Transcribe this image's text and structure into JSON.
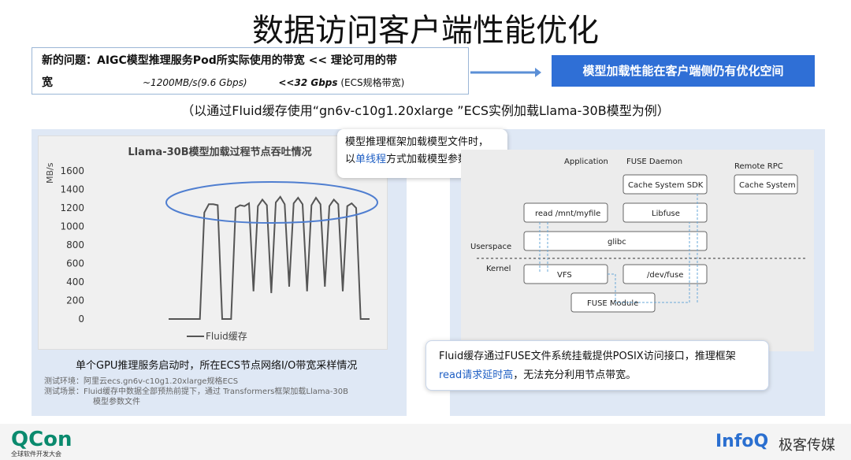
{
  "title": "数据访问客户端性能优化",
  "problem": {
    "line1": "新的问题：AIGC模型推理服务Pod所实际使用的带宽 << 理论可用的带",
    "line2": "宽",
    "actual": "~1200MB/s(9.6 Gbps)",
    "theory": "<<32 Gbps",
    "theory_note": "(ECS规格带宽)"
  },
  "conclusion": "模型加载性能在客户端侧仍有优化空间",
  "subtitle": "（以通过Fluid缓存使用“gn6v-c10g1.20xlarge ”ECS实例加载Llama-30B模型为例）",
  "callout1": {
    "line1": "模型推理框架加载模型文件时，",
    "pre": "以",
    "hl": "单线程",
    "post": "方式加载模型参数"
  },
  "caption1": "单个GPU推理服务启动时，所在ECS节点网络I/O带宽采样情况",
  "testenv": {
    "line1": "测试环境：阿里云ecs.gn6v-c10g1.20xlarge规格ECS",
    "line2": "测试场景：Fluid缓存中数据全部预热前提下，通过 Transformers框架加载Llama-30B",
    "line3": "模型参数文件"
  },
  "callout2": {
    "line1": "Fluid缓存通过FUSE文件系统挂载提供POSIX访问接口，推理框架",
    "hl": "read请求延时高",
    "post": "，无法充分利用节点带宽。"
  },
  "diagram": {
    "application": "Application",
    "fuse_daemon": "FUSE Daemon",
    "remote_rpc": "Remote RPC",
    "sdk": "Cache System SDK",
    "cache_system": "Cache System",
    "read": "read /mnt/myfile",
    "libfuse": "Libfuse",
    "glibc": "glibc",
    "userspace": "Userspace",
    "kernel": "Kernel",
    "vfs": "VFS",
    "devfuse": "/dev/fuse",
    "fuse_module": "FUSE Module"
  },
  "footer": {
    "qcon": "QCon",
    "qcon_sub": "全球软件开发大会",
    "infoq": "InfoQ",
    "jike": "极客传媒"
  },
  "chart_data": {
    "type": "line",
    "title": "Llama-30B模型加载过程节点吞吐情况",
    "ylabel": "MB/s",
    "ylim": [
      0,
      1600
    ],
    "yticks": [
      0,
      200,
      400,
      600,
      800,
      1000,
      1200,
      1400,
      1600
    ],
    "series": [
      {
        "name": "Fluid缓存",
        "color": "#555555",
        "values": [
          0,
          0,
          0,
          0,
          0,
          0,
          0,
          0,
          1150,
          1240,
          1240,
          1230,
          0,
          0,
          0,
          1200,
          1230,
          1220,
          1250,
          300,
          1220,
          1290,
          1230,
          280,
          1260,
          1320,
          1240,
          350,
          1250,
          1310,
          1240,
          300,
          1230,
          1310,
          1240,
          350,
          1220,
          1290,
          1240,
          300,
          1220,
          1250,
          1200,
          0,
          0,
          0
        ]
      }
    ]
  }
}
